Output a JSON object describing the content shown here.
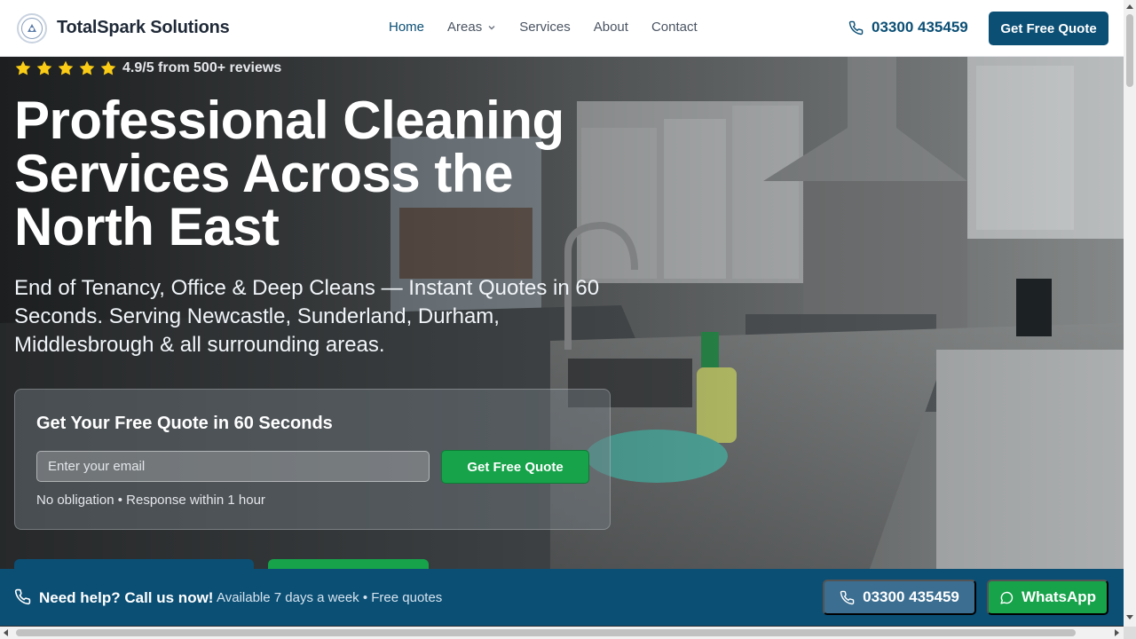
{
  "brand": {
    "name": "TotalSpark Solutions"
  },
  "nav": {
    "items": [
      {
        "label": "Home",
        "active": true
      },
      {
        "label": "Areas",
        "has_dropdown": true
      },
      {
        "label": "Services"
      },
      {
        "label": "About"
      },
      {
        "label": "Contact"
      }
    ],
    "phone": "03300 435459",
    "cta_label": "Get Free Quote"
  },
  "hero": {
    "rating": {
      "stars": 5,
      "text": "4.9/5 from 500+ reviews"
    },
    "title_lines": [
      "Professional Cleaning",
      "Services Across the",
      "North East"
    ],
    "subtitle_lines": [
      "End of Tenancy, Office & Deep Cleans — Instant Quotes in 60",
      "Seconds. Serving Newcastle, Sunderland, Durham,",
      "Middlesbrough & all surrounding areas."
    ],
    "background": "kitchen-photo"
  },
  "quote_form": {
    "title": "Get Your Free Quote in 60 Seconds",
    "email_placeholder": "Enter your email",
    "email_value": "",
    "button_label": "Get Free Quote",
    "note": "No obligation • Response within 1 hour"
  },
  "help_bar": {
    "title": "Need help? Call us now!",
    "subtitle": "Available 7 days a week • Free quotes",
    "phone_label": "03300 435459",
    "whatsapp_label": "WhatsApp"
  },
  "colors": {
    "primary": "#0b4f75",
    "success": "#16a34a",
    "star": "#facc15"
  },
  "icons": {
    "phone": "phone-icon",
    "whatsapp": "whatsapp-icon",
    "star": "star-icon",
    "chevron": "chevron-down-icon"
  }
}
